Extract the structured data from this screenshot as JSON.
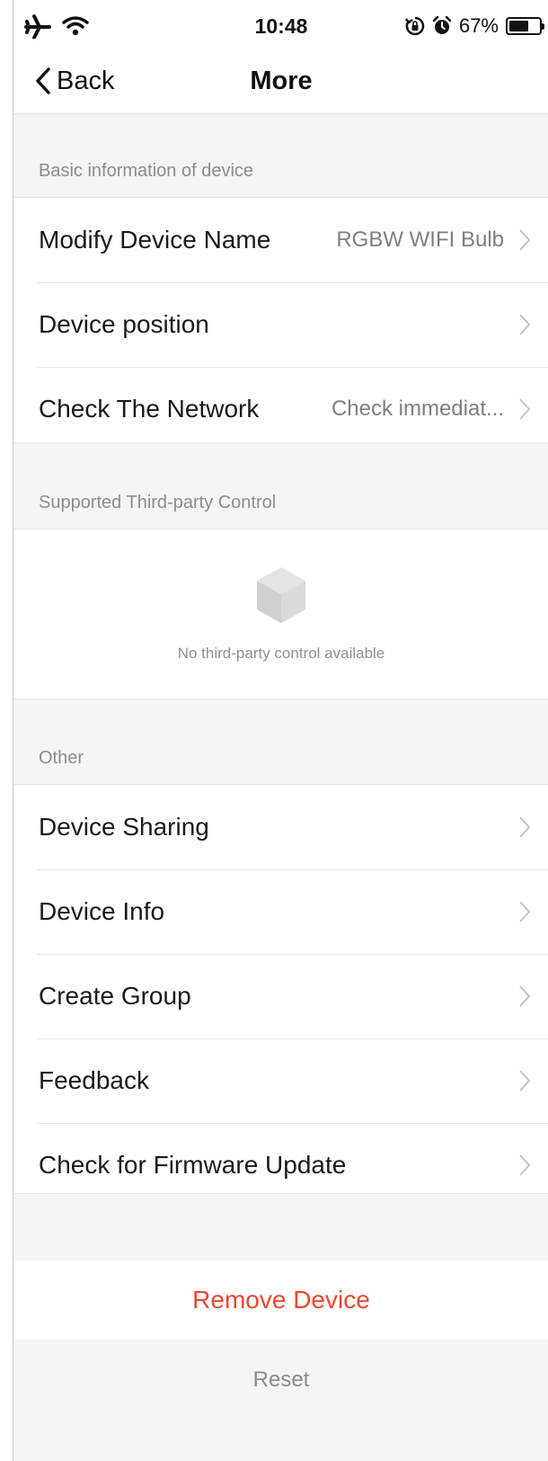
{
  "status_bar": {
    "time": "10:48",
    "battery_percent": "67%",
    "battery_level": 0.67,
    "icons": [
      "airplane-icon",
      "wifi-icon",
      "rotation-lock-icon",
      "alarm-icon",
      "battery-icon"
    ]
  },
  "nav": {
    "back_label": "Back",
    "title": "More"
  },
  "sections": {
    "basic": {
      "header": "Basic information of device",
      "rows": [
        {
          "label": "Modify Device Name",
          "value": "RGBW WIFI Bulb"
        },
        {
          "label": "Device position",
          "value": ""
        },
        {
          "label": "Check The Network",
          "value": "Check immediat..."
        }
      ]
    },
    "third_party": {
      "header": "Supported Third-party Control",
      "empty_text": "No third-party control available"
    },
    "other": {
      "header": "Other",
      "rows": [
        {
          "label": "Device Sharing"
        },
        {
          "label": "Device Info"
        },
        {
          "label": "Create Group"
        },
        {
          "label": "Feedback"
        },
        {
          "label": "Check for Firmware Update"
        }
      ]
    }
  },
  "actions": {
    "remove_device": "Remove Device",
    "reset": "Reset"
  },
  "colors": {
    "destructive": "#f0462d",
    "secondary_text": "#8c8c8c",
    "background": "#f5f5f5"
  }
}
